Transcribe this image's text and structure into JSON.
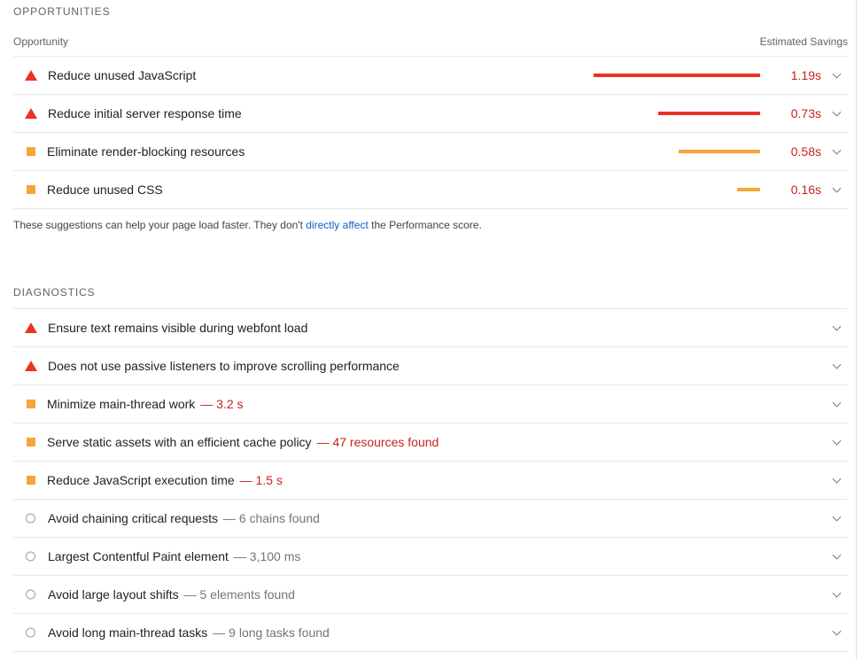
{
  "opportunities": {
    "section_title": "OPPORTUNITIES",
    "column_left": "Opportunity",
    "column_right": "Estimated Savings",
    "items": [
      {
        "title": "Reduce unused JavaScript",
        "status": "fail",
        "savings": "1.19s",
        "savings_fraction": 1.0
      },
      {
        "title": "Reduce initial server response time",
        "status": "fail",
        "savings": "0.73s",
        "savings_fraction": 0.613
      },
      {
        "title": "Eliminate render-blocking resources",
        "status": "average",
        "savings": "0.58s",
        "savings_fraction": 0.489
      },
      {
        "title": "Reduce unused CSS",
        "status": "average",
        "savings": "0.16s",
        "savings_fraction": 0.138
      }
    ],
    "note": {
      "before": "These suggestions can help your page load faster. They don't ",
      "link": "directly affect",
      "after": " the Performance score."
    }
  },
  "diagnostics": {
    "section_title": "DIAGNOSTICS",
    "items": [
      {
        "title": "Ensure text remains visible during webfont load",
        "status": "fail",
        "detail": ""
      },
      {
        "title": "Does not use passive listeners to improve scrolling performance",
        "status": "fail",
        "detail": ""
      },
      {
        "title": "Minimize main-thread work",
        "status": "average",
        "detail": "— 3.2 s"
      },
      {
        "title": "Serve static assets with an efficient cache policy",
        "status": "average",
        "detail": "— 47 resources found"
      },
      {
        "title": "Reduce JavaScript execution time",
        "status": "average",
        "detail": "— 1.5 s"
      },
      {
        "title": "Avoid chaining critical requests",
        "status": "info",
        "detail": "— 6 chains found"
      },
      {
        "title": "Largest Contentful Paint element",
        "status": "info",
        "detail": "— 3,100 ms"
      },
      {
        "title": "Avoid large layout shifts",
        "status": "info",
        "detail": "— 5 elements found"
      },
      {
        "title": "Avoid long main-thread tasks",
        "status": "info",
        "detail": "— 9 long tasks found"
      }
    ]
  },
  "icons": {
    "fail": "fail-triangle-icon",
    "average": "average-square-icon",
    "info": "info-circle-icon",
    "expand": "chevron-down-icon"
  },
  "colors": {
    "fail": "#eb3223",
    "average": "#f7a43a",
    "savings_text": "#c5221f",
    "link": "#1a5ac8"
  }
}
